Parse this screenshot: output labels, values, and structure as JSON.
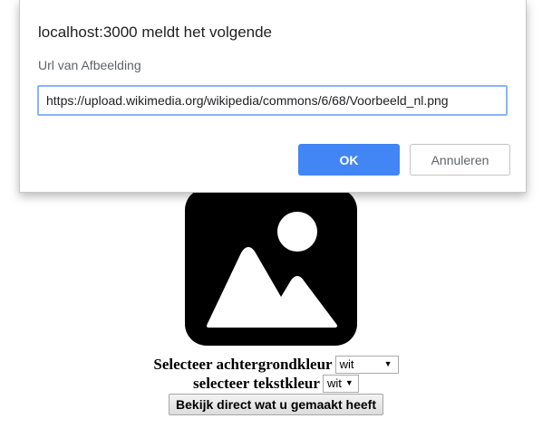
{
  "dialog": {
    "title": "localhost:3000 meldt het volgende",
    "message": "Url van Afbeelding",
    "input_value": "https://upload.wikimedia.org/wikipedia/commons/6/68/Voorbeeld_nl.png",
    "ok_label": "OK",
    "cancel_label": "Annuleren",
    "accent_color": "#4285f4"
  },
  "page": {
    "image_icon": "image-placeholder-icon",
    "background_label": "Selecteer achtergrondkleur",
    "background_value": "wit",
    "text_label": "selecteer tekstkleur",
    "text_value": "wit",
    "preview_button": "Bekijk direct wat u gemaakt heeft"
  }
}
